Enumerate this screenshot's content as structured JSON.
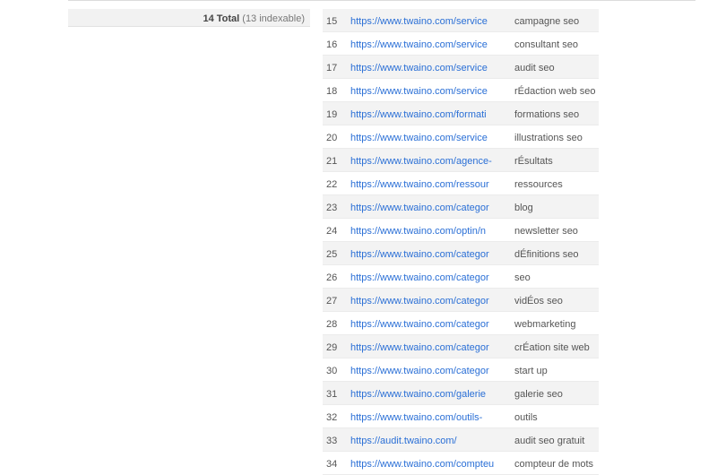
{
  "summary": {
    "total_label": "14 Total",
    "indexable_label": "(13 indexable)"
  },
  "rows": [
    {
      "num": "15",
      "url": "https://www.twaino.com/service",
      "anchor": "campagne seo"
    },
    {
      "num": "16",
      "url": "https://www.twaino.com/service",
      "anchor": "consultant seo"
    },
    {
      "num": "17",
      "url": "https://www.twaino.com/service",
      "anchor": "audit seo"
    },
    {
      "num": "18",
      "url": "https://www.twaino.com/service",
      "anchor": "rÉdaction web seo"
    },
    {
      "num": "19",
      "url": "https://www.twaino.com/formati",
      "anchor": "formations seo"
    },
    {
      "num": "20",
      "url": "https://www.twaino.com/service",
      "anchor": "illustrations seo"
    },
    {
      "num": "21",
      "url": "https://www.twaino.com/agence-",
      "anchor": "rÉsultats"
    },
    {
      "num": "22",
      "url": "https://www.twaino.com/ressour",
      "anchor": "ressources"
    },
    {
      "num": "23",
      "url": "https://www.twaino.com/categor",
      "anchor": "blog"
    },
    {
      "num": "24",
      "url": "https://www.twaino.com/optin/n",
      "anchor": "newsletter seo"
    },
    {
      "num": "25",
      "url": "https://www.twaino.com/categor",
      "anchor": "dÉfinitions seo"
    },
    {
      "num": "26",
      "url": "https://www.twaino.com/categor",
      "anchor": "seo"
    },
    {
      "num": "27",
      "url": "https://www.twaino.com/categor",
      "anchor": "vidÉos seo"
    },
    {
      "num": "28",
      "url": "https://www.twaino.com/categor",
      "anchor": "webmarketing"
    },
    {
      "num": "29",
      "url": "https://www.twaino.com/categor",
      "anchor": "crÉation site web"
    },
    {
      "num": "30",
      "url": "https://www.twaino.com/categor",
      "anchor": "start up"
    },
    {
      "num": "31",
      "url": "https://www.twaino.com/galerie",
      "anchor": "galerie seo"
    },
    {
      "num": "32",
      "url": "https://www.twaino.com/outils-",
      "anchor": "outils"
    },
    {
      "num": "33",
      "url": "https://audit.twaino.com/",
      "anchor": "audit seo gratuit"
    },
    {
      "num": "34",
      "url": "https://www.twaino.com/compteu",
      "anchor": "compteur de mots"
    }
  ],
  "colors": {
    "link": "#2a6fd6",
    "row_alt_bg": "#f3f3f3",
    "summary_bg": "#f2f2f2"
  }
}
